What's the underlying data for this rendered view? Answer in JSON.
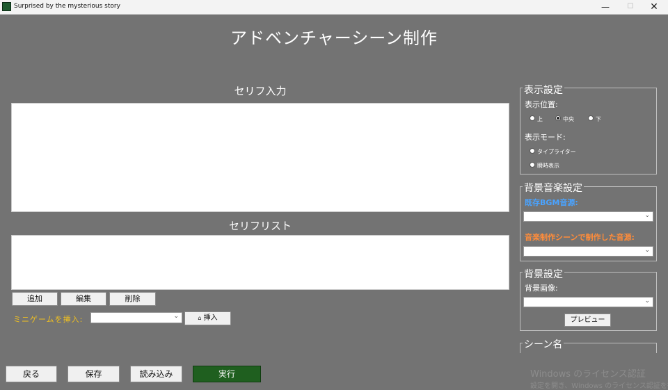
{
  "window": {
    "title": "Surprised by the mysterious story",
    "minimize": "—",
    "maximize": "☐",
    "close": "✕"
  },
  "header": {
    "title": "アドベンチャーシーン制作"
  },
  "dialogue_input": {
    "heading": "セリフ入力"
  },
  "dialogue_list": {
    "heading": "セリフリスト"
  },
  "list_buttons": {
    "add": "追加",
    "edit": "編集",
    "delete": "削除"
  },
  "minigame": {
    "label": "ミニゲームを挿入:",
    "selected": "",
    "insert_icon": "⌂",
    "insert_label": "挿入"
  },
  "display_settings": {
    "title": "表示設定",
    "position_label": "表示位置:",
    "positions": [
      "上",
      "中央",
      "下"
    ],
    "selected_position": "中央",
    "mode_label": "表示モード:",
    "modes": [
      "タイプライター",
      "瞬時表示"
    ],
    "selected_mode": ""
  },
  "bgm_settings": {
    "title": "背景音楽設定",
    "existing_label": "既存BGM音源:",
    "existing_selected": "",
    "created_label": "音楽制作シーンで制作した音源:",
    "created_selected": "",
    "colors": {
      "existing": "#4aa3ff",
      "created": "#ff8c3a"
    }
  },
  "background_settings": {
    "title": "背景設定",
    "image_label": "背景画像:",
    "image_selected": "",
    "preview": "プレビュー"
  },
  "scene_name": {
    "title": "シーン名"
  },
  "bottom_buttons": {
    "back": "戻る",
    "save": "保存",
    "load": "読み込み",
    "run": "実行"
  },
  "watermark": {
    "line1": "Windows のライセンス認証",
    "line2": "設定を開き、Windows のライセンス認証を行"
  },
  "colors": {
    "background": "#737373",
    "run_button": "#1f5f1f",
    "minigame_label": "#f0c020"
  }
}
